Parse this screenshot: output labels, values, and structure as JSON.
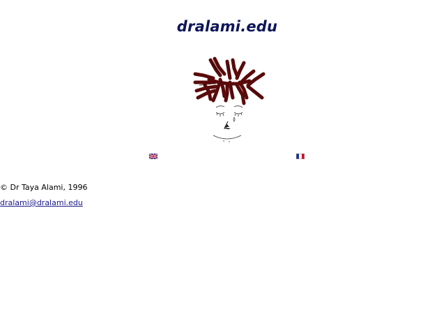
{
  "header": {
    "title": "dralami.edu"
  },
  "portrait": {
    "icon": "face-drawing-icon",
    "hair_color": "#5a0a0a"
  },
  "languages": [
    {
      "code": "en",
      "icon": "uk-flag-icon"
    },
    {
      "code": "fr",
      "icon": "france-flag-icon"
    }
  ],
  "footer": {
    "copyright": "© Dr Taya Alami, 1996",
    "email": "dralami@dralami.edu"
  },
  "colors": {
    "title": "#0d1659",
    "link": "#1a1a8c"
  }
}
